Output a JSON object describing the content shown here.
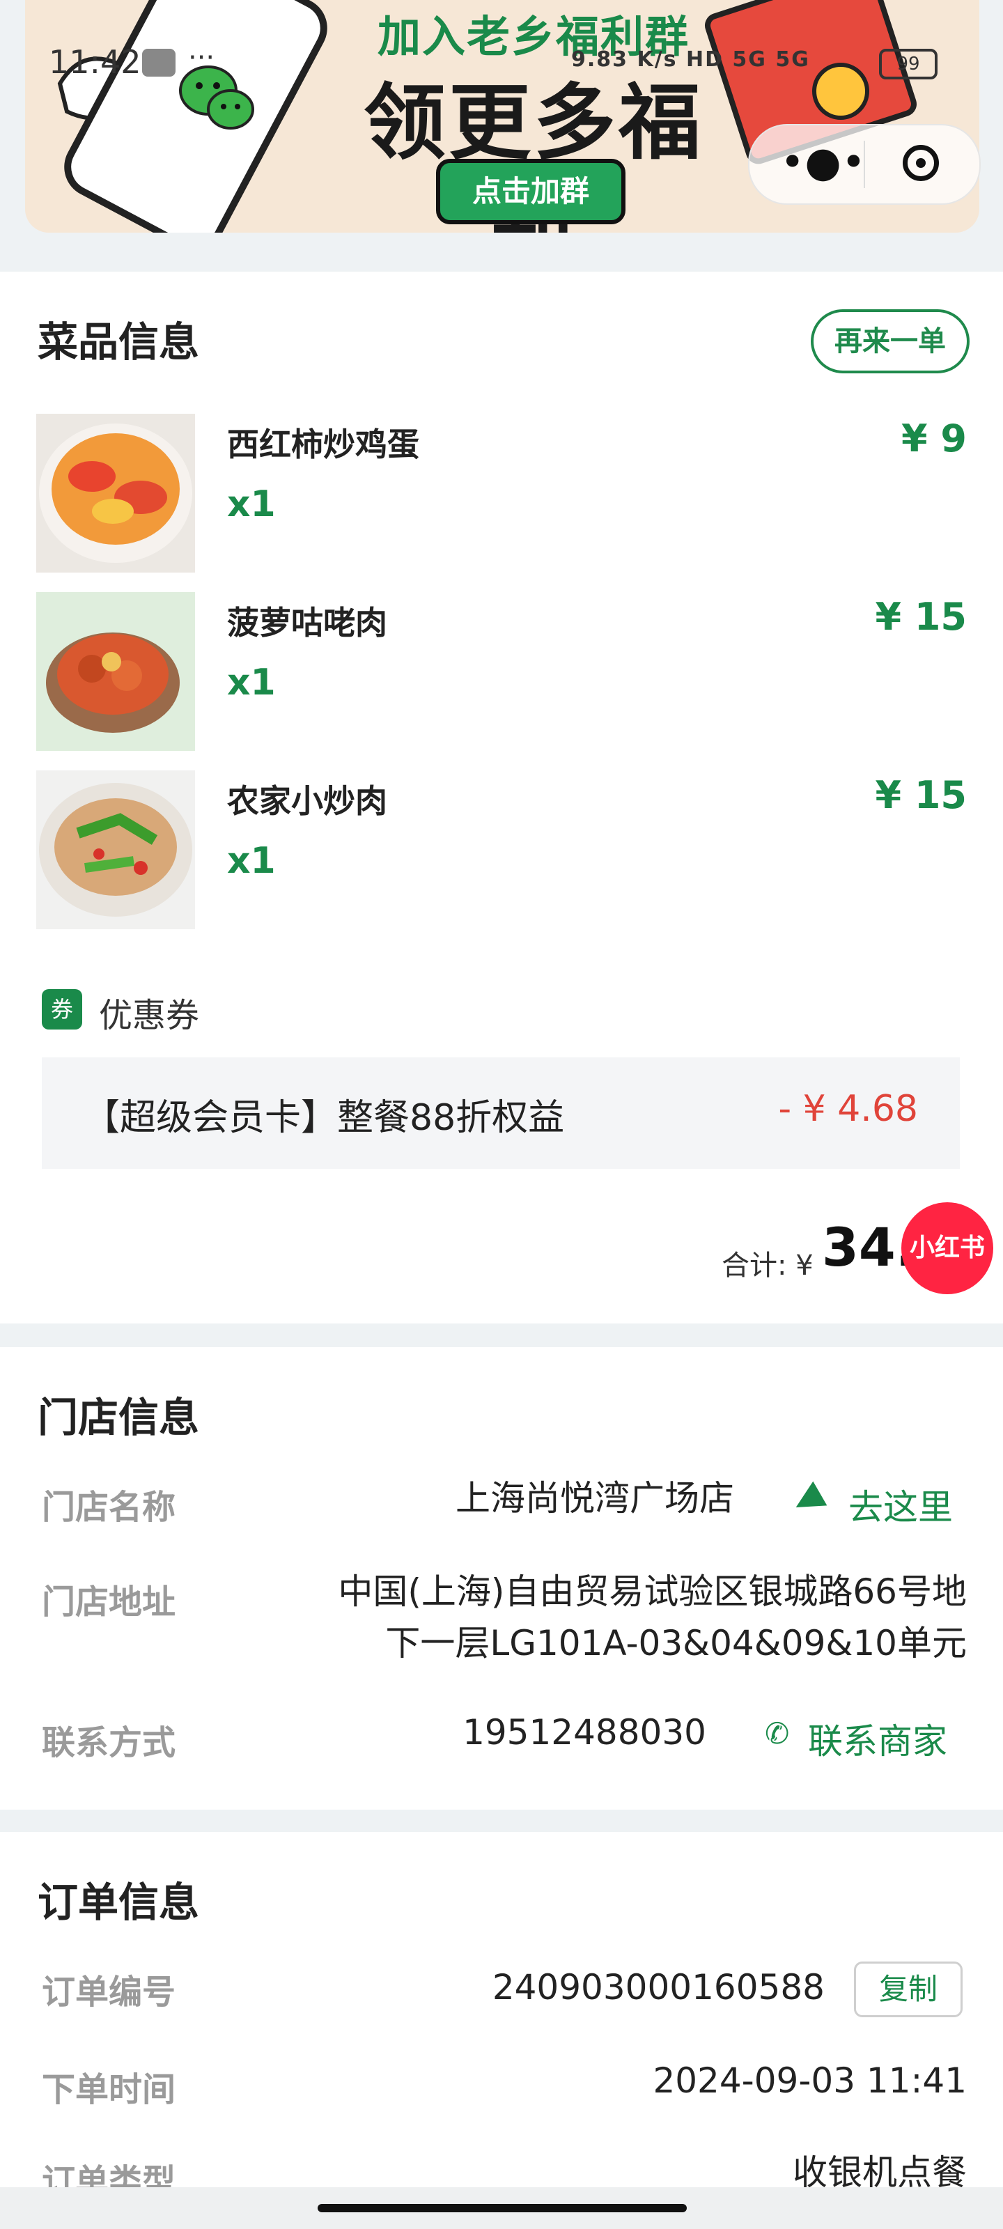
{
  "status_bar": {
    "time": "11:42",
    "dots": "···",
    "right_text": "9.83 K/s  HD  5G  5G",
    "battery": "99"
  },
  "banner": {
    "line1": "加入老乡福利群",
    "line2": "领更多福利",
    "button": "点击加群"
  },
  "capsule": {
    "more": "•●•"
  },
  "dishes_section": {
    "title": "菜品信息",
    "reorder": "再来一单",
    "items": [
      {
        "name": "西红柿炒鸡蛋",
        "qty": "x1",
        "price": "¥ 9"
      },
      {
        "name": "菠萝咕咾肉",
        "qty": "x1",
        "price": "¥ 15"
      },
      {
        "name": "农家小炒肉",
        "qty": "x1",
        "price": "¥ 15"
      }
    ],
    "coupon_tag": "券",
    "coupon_label": "优惠券",
    "coupon_name": "【超级会员卡】整餐88折权益",
    "coupon_discount": "- ¥ 4.68",
    "total_label": "合计: ¥",
    "total_value": "34.",
    "xhs_badge": "小红书"
  },
  "store_section": {
    "title": "门店信息",
    "name_label": "门店名称",
    "name_value": "上海尚悦湾广场店",
    "nav_link": "去这里",
    "address_label": "门店地址",
    "address_line1": "中国(上海)自由贸易试验区银城路66号地",
    "address_line2": "下一层LG101A-03&04&09&10单元",
    "contact_label": "联系方式",
    "contact_value": "19512488030",
    "contact_link": "联系商家",
    "phone_icon": "✆"
  },
  "order_section": {
    "title": "订单信息",
    "number_label": "订单编号",
    "number_value": "240903000160588",
    "copy": "复制",
    "time_label": "下单时间",
    "time_value": "2024-09-03 11:41",
    "type_label": "订单类型",
    "type_value": "收银机点餐"
  }
}
